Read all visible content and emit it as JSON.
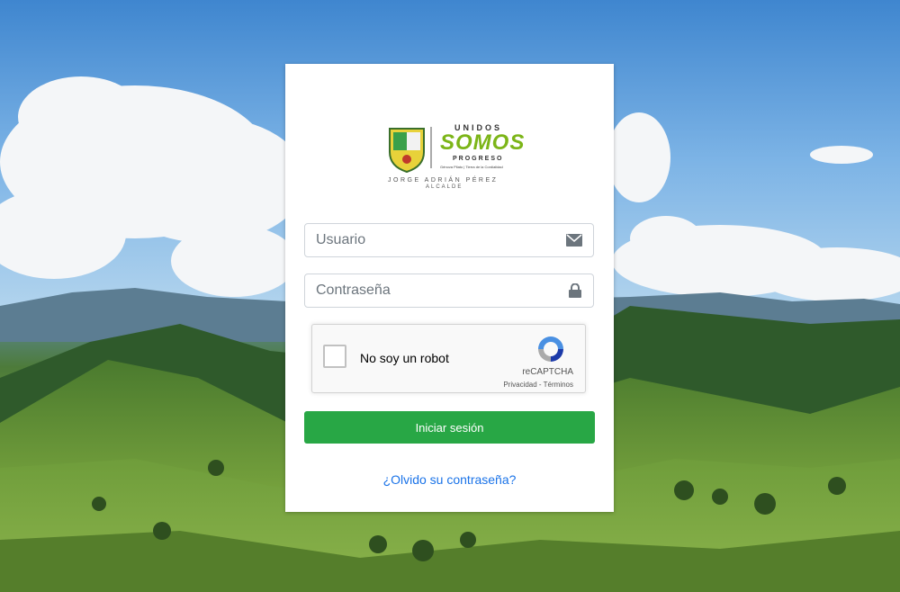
{
  "logo": {
    "line1": "UNIDOS",
    "line2": "SOMOS",
    "line3": "PROGRESO",
    "tagline": "Génova Pilato | Tierra de la Cordialidad",
    "name": "JORGE ADRIÁN PÉREZ",
    "role": "ALCALDE"
  },
  "form": {
    "username_placeholder": "Usuario",
    "password_placeholder": "Contraseña",
    "login_label": "Iniciar sesión",
    "forgot_label": "¿Olvido su contraseña?"
  },
  "recaptcha": {
    "label": "No soy un robot",
    "brand": "reCAPTCHA",
    "links": "Privacidad - Términos"
  },
  "colors": {
    "primary_button": "#28a745",
    "link": "#1a73e8"
  },
  "icons": {
    "username": "envelope-icon",
    "password": "lock-icon"
  }
}
